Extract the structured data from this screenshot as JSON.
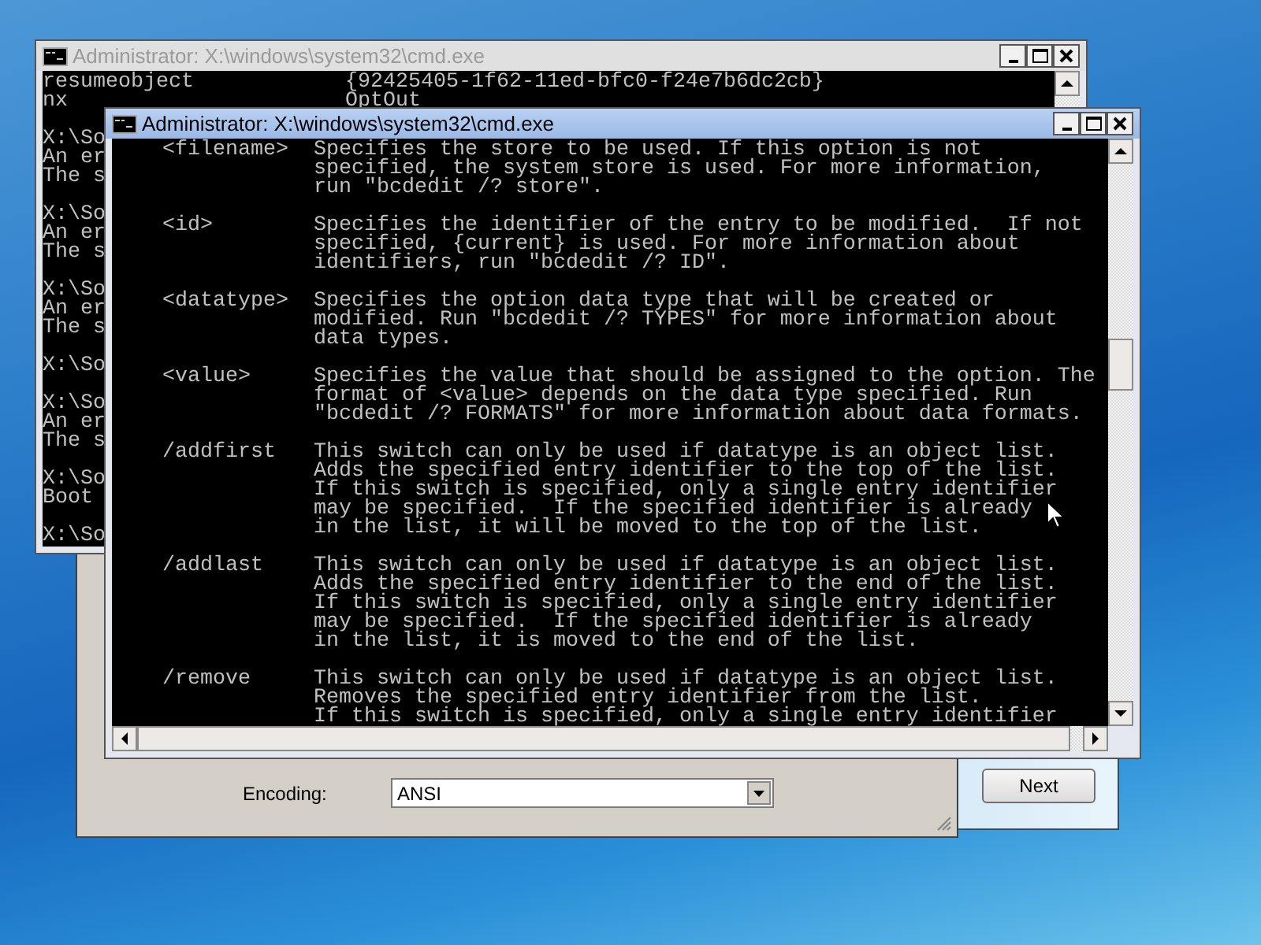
{
  "setup_window": {
    "next_button": "Next"
  },
  "setup_dialog": {
    "encoding_label": "Encoding:",
    "encoding_value": "ANSI"
  },
  "back_console": {
    "title": "Administrator: X:\\windows\\system32\\cmd.exe",
    "active": false,
    "pairs": [
      {
        "key": "resumeobject",
        "value": "{92425405-1f62-11ed-bfc0-f24e7b6dc2cb}"
      },
      {
        "key": "nx",
        "value": "OptOut"
      }
    ],
    "groups": [
      [
        "X:\\So",
        "An er",
        "The s"
      ],
      [
        "X:\\So",
        "An er",
        "The s"
      ],
      [
        "X:\\So",
        "An er",
        "The s"
      ],
      [
        "X:\\So"
      ],
      [
        "X:\\So",
        "An er",
        "The s"
      ],
      [
        "X:\\So",
        "Boot"
      ],
      [
        "X:\\So"
      ]
    ]
  },
  "front_console": {
    "title": "Administrator: X:\\windows\\system32\\cmd.exe",
    "active": true,
    "entries": [
      {
        "term": "<filename>",
        "lines": [
          "Specifies the store to be used. If this option is not",
          "specified, the system store is used. For more information,",
          "run \"bcdedit /? store\"."
        ]
      },
      {
        "term": "<id>",
        "lines": [
          "Specifies the identifier of the entry to be modified.  If not",
          "specified, {current} is used. For more information about",
          "identifiers, run \"bcdedit /? ID\"."
        ]
      },
      {
        "term": "<datatype>",
        "lines": [
          "Specifies the option data type that will be created or",
          "modified. Run \"bcdedit /? TYPES\" for more information about",
          "data types."
        ]
      },
      {
        "term": "<value>",
        "lines": [
          "Specifies the value that should be assigned to the option. The",
          "format of <value> depends on the data type specified. Run",
          "\"bcdedit /? FORMATS\" for more information about data formats."
        ]
      },
      {
        "term": "/addfirst",
        "lines": [
          "This switch can only be used if datatype is an object list.",
          "Adds the specified entry identifier to the top of the list.",
          "If this switch is specified, only a single entry identifier",
          "may be specified.  If the specified identifier is already",
          "in the list, it will be moved to the top of the list."
        ]
      },
      {
        "term": "/addlast",
        "lines": [
          "This switch can only be used if datatype is an object list.",
          "Adds the specified entry identifier to the end of the list.",
          "If this switch is specified, only a single entry identifier",
          "may be specified.  If the specified identifier is already",
          "in the list, it is moved to the end of the list."
        ]
      },
      {
        "term": "/remove",
        "lines": [
          "This switch can only be used if datatype is an object list.",
          "Removes the specified entry identifier from the list.",
          "If this switch is specified, only a single entry identifier"
        ]
      }
    ]
  }
}
